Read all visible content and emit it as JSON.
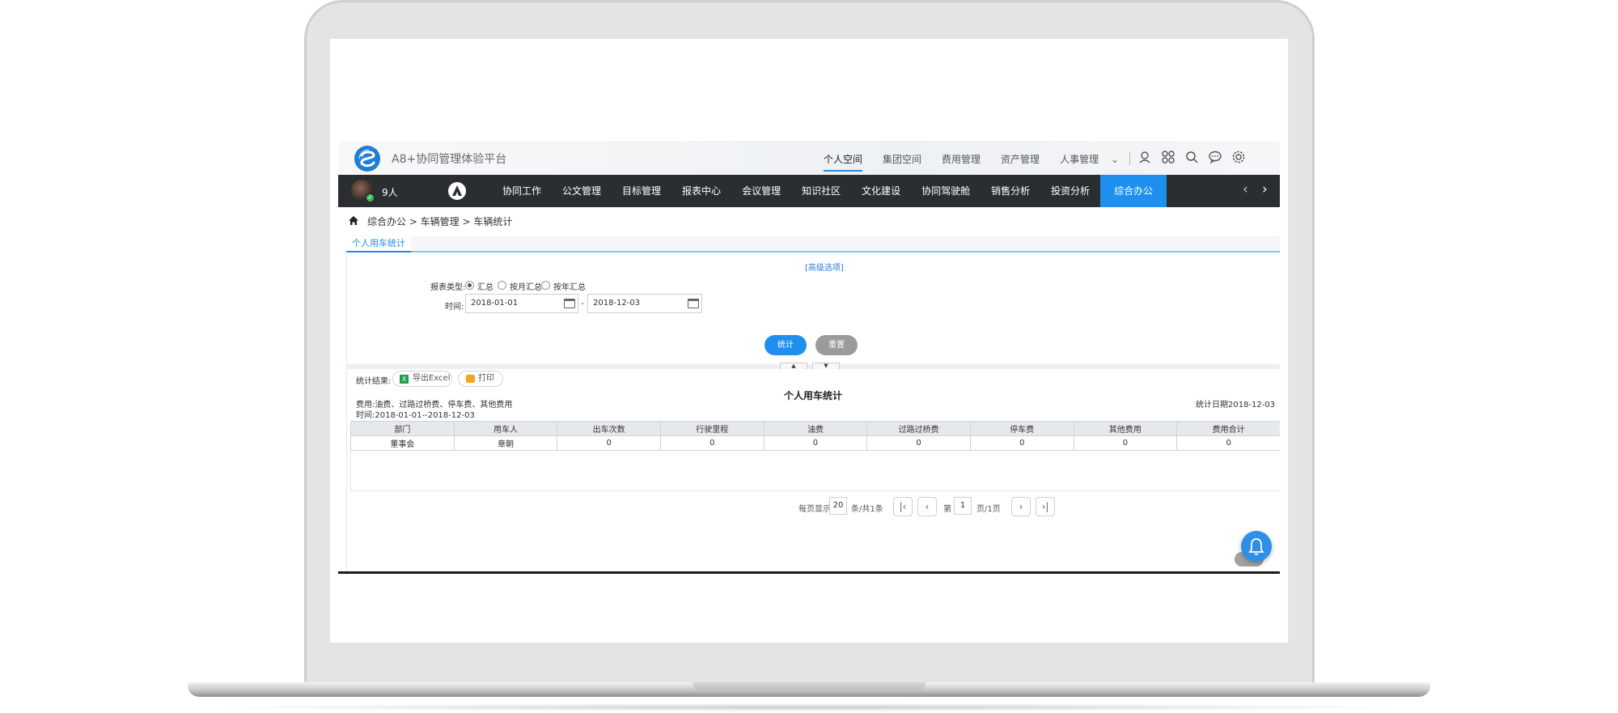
{
  "header": {
    "app_title": "A8+协同管理体验平台",
    "top_tabs": [
      "个人空间",
      "集团空间",
      "费用管理",
      "资产管理",
      "人事管理"
    ],
    "active_top_tab": "个人空间",
    "top_icons": [
      "location-icon",
      "apps-icon",
      "search-icon",
      "message-icon",
      "settings-icon"
    ]
  },
  "navbar": {
    "online_count": "9人",
    "items": [
      "协同工作",
      "公文管理",
      "目标管理",
      "报表中心",
      "会议管理",
      "知识社区",
      "文化建设",
      "协同驾驶舱",
      "销售分析",
      "投资分析",
      "综合办公"
    ],
    "active_item": "综合办公"
  },
  "breadcrumb": "综合办公 > 车辆管理 > 车辆统计",
  "tab": "个人用车统计",
  "form": {
    "advanced_link": "[高级选项]",
    "report_type_label": "报表类型:",
    "report_types": [
      "汇总",
      "按月汇总",
      "按年汇总"
    ],
    "selected_report_type": "汇总",
    "time_label": "时间:",
    "date_from": "2018-01-01",
    "date_to": "2018-12-03",
    "date_separator": "-",
    "submit_label": "统计",
    "reset_label": "重置"
  },
  "result": {
    "label": "统计结果:",
    "export_label": "导出Excel",
    "print_label": "打印",
    "report_title": "个人用车统计",
    "fee_note": "费用:油费、过路过桥费、停车费、其他费用",
    "time_note": "时间:2018-01-01--2018-12-03",
    "stat_date": "统计日期2018-12-03",
    "columns": [
      "部门",
      "用车人",
      "出车次数",
      "行驶里程",
      "油费",
      "过路过桥费",
      "停车费",
      "其他费用",
      "费用合计"
    ],
    "rows": [
      [
        "董事会",
        "章朝",
        "0",
        "0",
        "0",
        "0",
        "0",
        "0",
        "0"
      ]
    ]
  },
  "pager": {
    "per_page_label": "每页显示",
    "per_page": "20",
    "total_label": "条/共1条",
    "page_prefix": "第",
    "page": "1",
    "page_suffix": "页/1页"
  },
  "colors": {
    "accent": "#1e8fef",
    "navbar_bg": "#2b2e31",
    "laptop_frame": "#e4e4e4"
  }
}
